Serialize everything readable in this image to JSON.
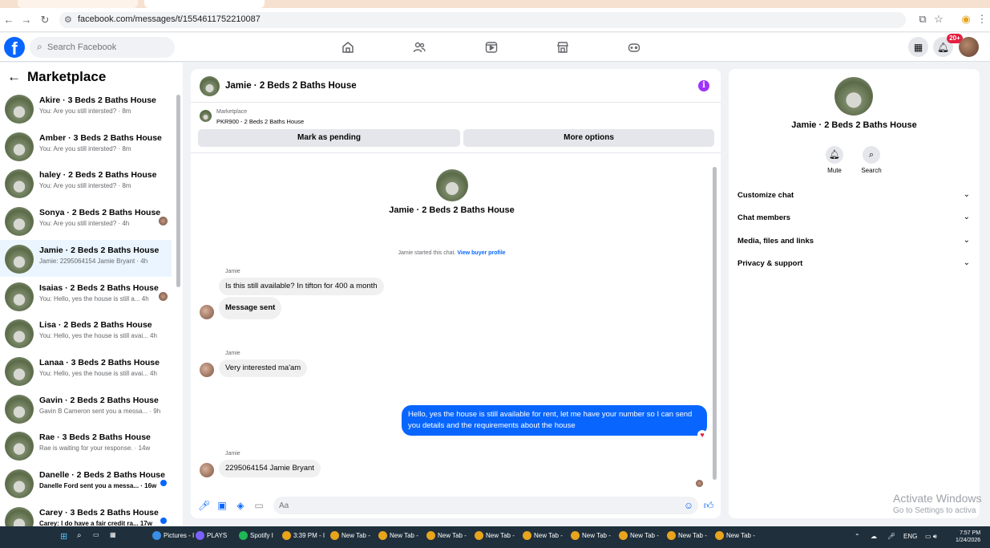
{
  "browser": {
    "url": "facebook.com/messages/t/1554611752210087"
  },
  "fb_nav": {
    "search_placeholder": "Search Facebook",
    "notification_count": "20+"
  },
  "sidebar": {
    "title": "Marketplace",
    "conversations": [
      {
        "title": "Akire · 3 Beds 2 Baths House",
        "preview": "You: Are you still intersted? · 8m",
        "indicator": "none"
      },
      {
        "title": "Amber · 3 Beds 2 Baths House",
        "preview": "You: Are you still intersted? · 8m",
        "indicator": "none"
      },
      {
        "title": "haley · 2 Beds 2 Baths House",
        "preview": "You: Are you still intersted? · 8m",
        "indicator": "none"
      },
      {
        "title": "Sonya · 2 Beds 2 Baths House",
        "preview": "You: Are you still intersted? · 4h",
        "indicator": "avatar"
      },
      {
        "title": "Jamie · 2 Beds 2 Baths House",
        "preview": "Jamie: 2295064154 Jamie Bryant · 4h",
        "indicator": "none",
        "active": true
      },
      {
        "title": "Isaias · 2 Beds 2 Baths House",
        "preview": "You: Hello, yes the house is still a... 4h",
        "indicator": "avatar"
      },
      {
        "title": "Lisa · 2 Beds 2 Baths House",
        "preview": "You: Hello, yes the house is still avai... 4h",
        "indicator": "none"
      },
      {
        "title": "Lanaa · 3 Beds 2 Baths House",
        "preview": "You: Hello, yes the house is still avai... 4h",
        "indicator": "none"
      },
      {
        "title": "Gavin · 2 Beds 2 Baths House",
        "preview": "Gavin B Cameron sent you a messa... · 9h",
        "indicator": "none"
      },
      {
        "title": "Rae · 3 Beds 2 Baths House",
        "preview": "Rae is waiting for your response. · 14w",
        "indicator": "none"
      },
      {
        "title": "Danelle · 2 Beds 2 Baths House",
        "preview": "Danelle Ford sent you a messa... · 16w",
        "indicator": "unread",
        "bold": true
      },
      {
        "title": "Carey · 3 Beds 2 Baths House",
        "preview": "Carey: I do have a fair credit ra... 17w",
        "indicator": "unread",
        "bold": true
      }
    ]
  },
  "chat": {
    "header_name": "Jamie · 2 Beds 2 Baths House",
    "marketplace_label": "Marketplace",
    "listing_line": "PKR900 - 2 Beds 2 Baths House",
    "mark_pending_label": "Mark as pending",
    "more_options_label": "More options",
    "intro_name": "Jamie · 2 Beds 2 Baths House",
    "started_text": "Jamie started this chat.",
    "buyer_profile_link": "View buyer profile",
    "messages": {
      "m1_sender": "Jamie",
      "m1_text": "Is this still available?  In tifton for 400 a month",
      "m2_text": "Message sent",
      "m3_sender": "Jamie",
      "m3_text": "Very interested ma'am",
      "m4_text": "Hello, yes the house is still available for rent, let me have your number so I can send you details and the requirements about the house",
      "m5_sender": "Jamie",
      "m5_text": "2295064154 Jamie Bryant"
    },
    "composer_placeholder": "Aa"
  },
  "info_panel": {
    "name": "Jamie · 2 Beds 2 Baths House",
    "mute_label": "Mute",
    "search_label": "Search",
    "sections": [
      "Customize chat",
      "Chat members",
      "Media, files and links",
      "Privacy & support"
    ]
  },
  "watermark": {
    "line1": "Activate Windows",
    "line2": "Go to Settings to activa"
  },
  "taskbar": {
    "items": [
      "Pictures - I",
      "PLAYS",
      "Spotify I",
      "3:39 PM - I",
      "New Tab -",
      "New Tab -",
      "New Tab -",
      "New Tab -",
      "New Tab -",
      "New Tab -",
      "New Tab -",
      "New Tab -",
      "New Tab -"
    ],
    "lang": "ENG",
    "time": "7:57 PM",
    "date": "1/24/2026"
  },
  "colors": {
    "fb_blue": "#0866ff",
    "info_purple": "#a033ff",
    "unread_dot": "#0866ff",
    "taskbar_bg": "#1f2f3c"
  }
}
